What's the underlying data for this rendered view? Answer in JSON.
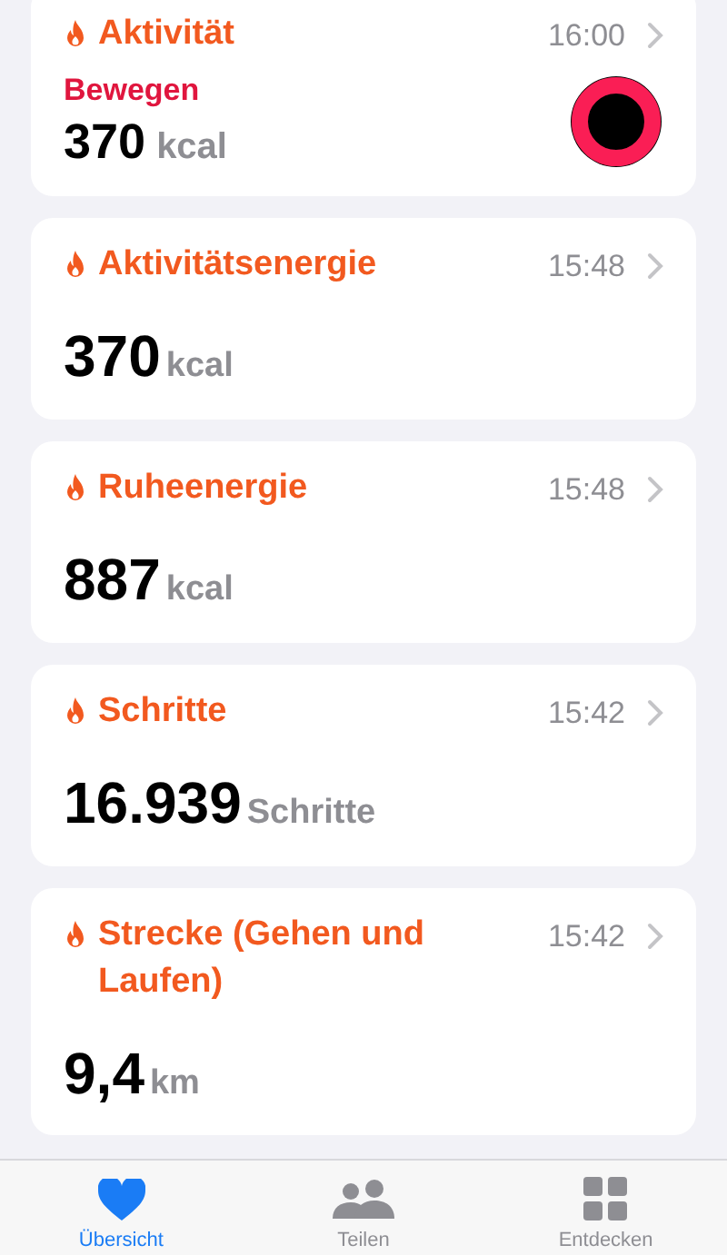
{
  "cards": [
    {
      "kind": "ring",
      "title": "Aktivität",
      "time": "16:00",
      "label": "Bewegen",
      "value": "370",
      "unit": "kcal"
    },
    {
      "kind": "metric",
      "title": "Aktivitätsenergie",
      "time": "15:48",
      "value": "370",
      "unit": "kcal"
    },
    {
      "kind": "metric",
      "title": "Ruheenergie",
      "time": "15:48",
      "value": "887",
      "unit": "kcal"
    },
    {
      "kind": "metric",
      "title": "Schritte",
      "time": "15:42",
      "value": "16.939",
      "unit": "Schritte"
    },
    {
      "kind": "metric",
      "title": "Strecke (Gehen und Laufen)",
      "time": "15:42",
      "value": "9,4",
      "unit": "km"
    }
  ],
  "tabs": [
    {
      "kind": "heart",
      "label": "Übersicht",
      "selected": true
    },
    {
      "kind": "people",
      "label": "Teilen",
      "selected": false
    },
    {
      "kind": "grid",
      "label": "Entdecken",
      "selected": false
    }
  ]
}
